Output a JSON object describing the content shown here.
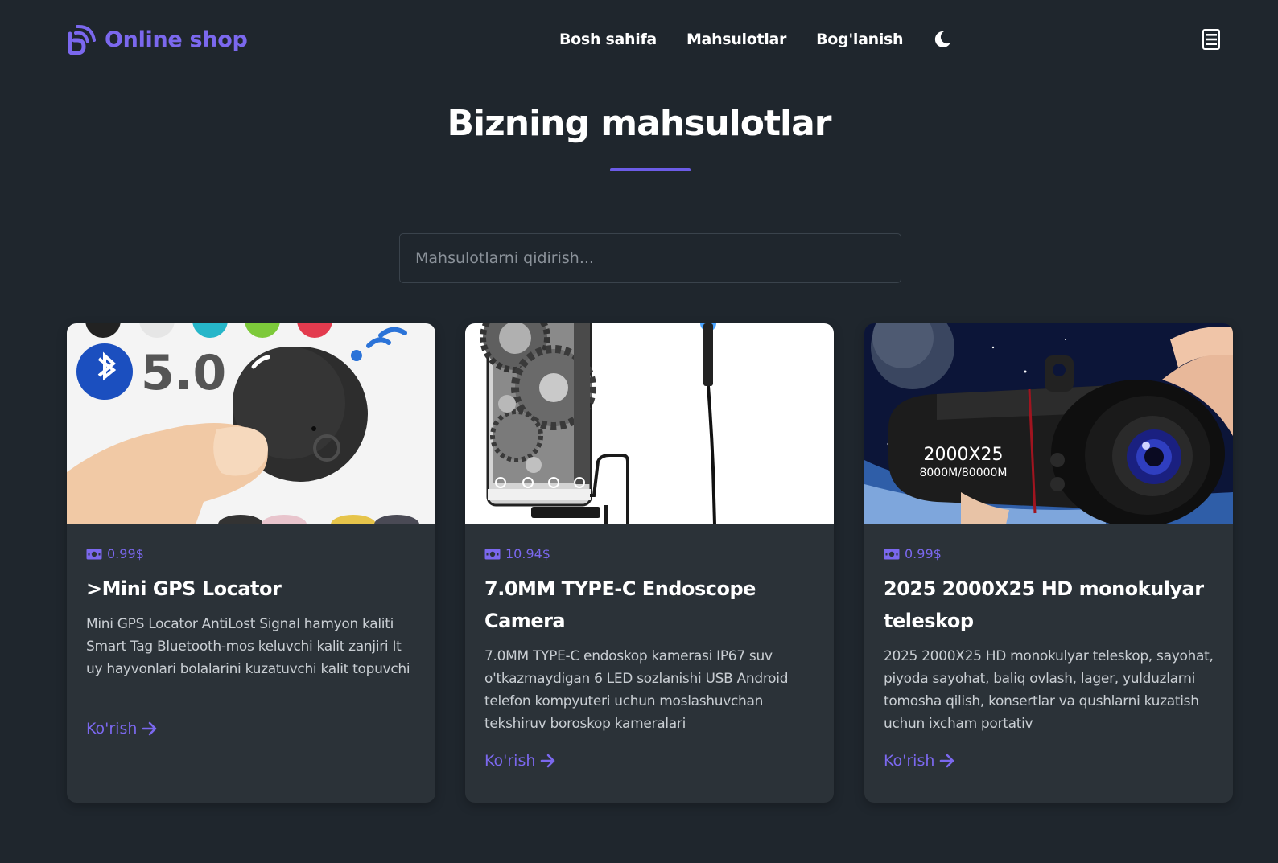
{
  "header": {
    "brand": "Online shop",
    "nav": [
      "Bosh sahifa",
      "Mahsulotlar",
      "Bog'lanish"
    ]
  },
  "main": {
    "title": "Bizning mahsulotlar",
    "search_placeholder": "Mahsulotlarni qidirish...",
    "products": [
      {
        "price": "0.99$",
        "title": ">Mini GPS Locator",
        "description": "Mini GPS Locator AntiLost Signal hamyon kaliti Smart Tag Bluetooth-mos keluvchi kalit zanjiri It uy hayvonlari bolalarini kuzatuvchi kalit topuvchi",
        "link": "Ko'rish",
        "image_text": "5.0"
      },
      {
        "price": "10.94$",
        "title": "7.0MM TYPE-C Endoscope Camera",
        "description": "7.0MM TYPE-C endoskop kamerasi IP67 suv o'tkazmaydigan 6 LED sozlanishi USB Android telefon kompyuteri uchun moslashuvchan tekshiruv boroskop kameralari",
        "link": "Ko'rish"
      },
      {
        "price": "0.99$",
        "title": "2025 2000X25 HD monokulyar teleskop",
        "description": "2025 2000X25 HD monokulyar teleskop, sayohat, piyoda sayohat, baliq ovlash, lager, yulduzlarni tomosha qilish, konsertlar va qushlarni kuzatish uchun ixcham portativ",
        "link": "Ko'rish",
        "image_text_1": "2000X25",
        "image_text_2": "8000M/80000M"
      }
    ]
  },
  "colors": {
    "background": "#1f262d",
    "card": "#2b3238",
    "accent": "#7b68ee"
  },
  "icons": [
    "logo-icon",
    "moon-icon",
    "menu-icon",
    "money-icon",
    "arrow-right-icon"
  ]
}
